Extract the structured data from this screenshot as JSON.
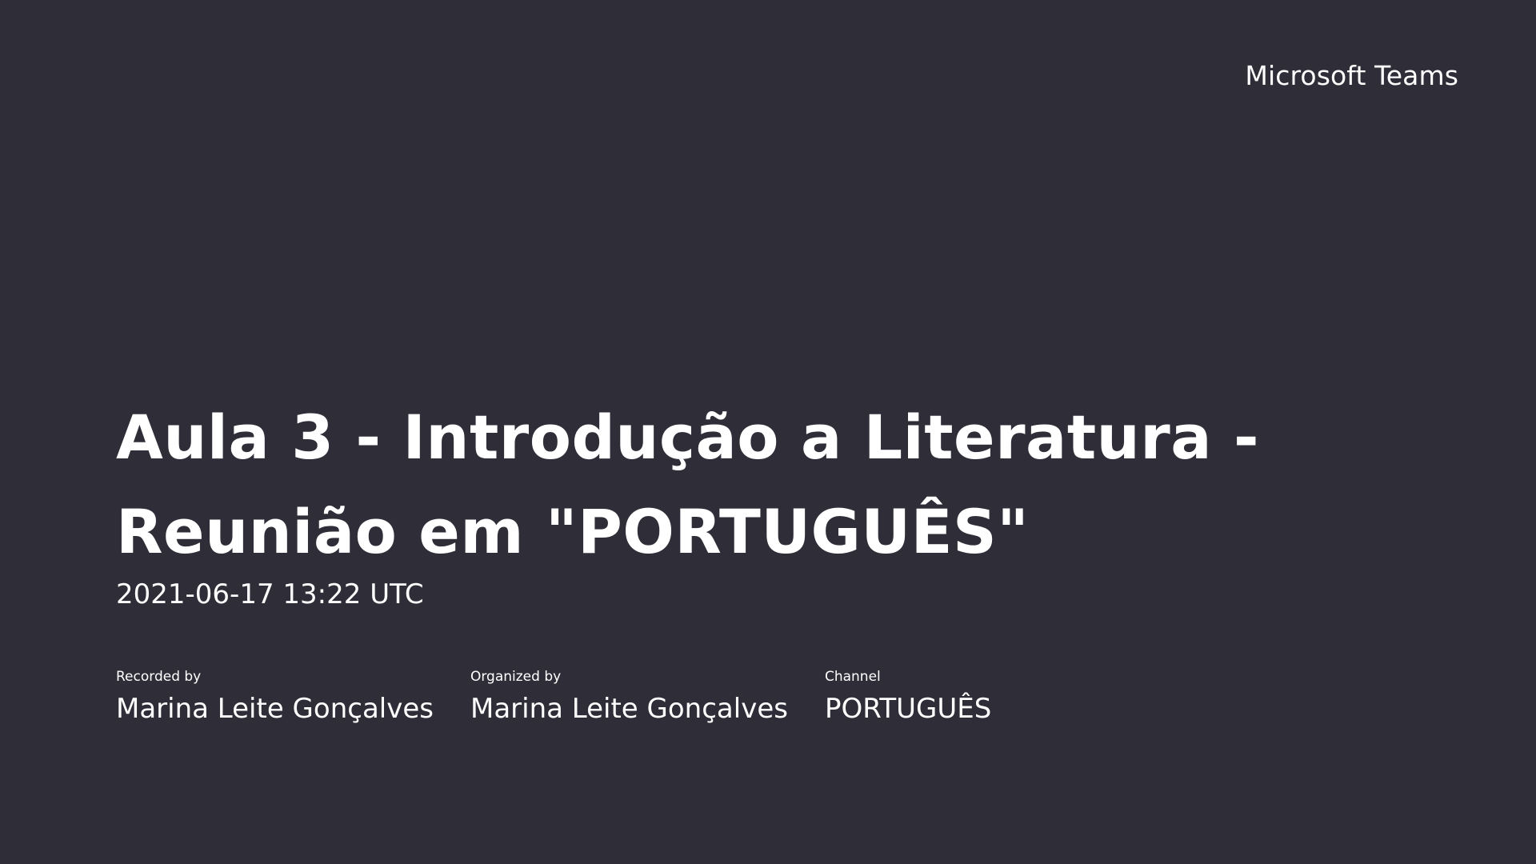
{
  "brand": {
    "name": "Microsoft Teams"
  },
  "meeting": {
    "title_line1": "Aula 3 - Introdução a Literatura -",
    "title_line2": "Reunião em \"PORTUGUÊS\"",
    "timestamp": "2021-06-17 13:22 UTC"
  },
  "details": {
    "recorded_by": {
      "label": "Recorded by",
      "value": "Marina Leite Gonçalves"
    },
    "organized_by": {
      "label": "Organized by",
      "value": "Marina Leite Gonçalves"
    },
    "channel": {
      "label": "Channel",
      "value": "PORTUGUÊS"
    }
  },
  "colors": {
    "background": "#2f2e38",
    "text": "#ffffff"
  }
}
